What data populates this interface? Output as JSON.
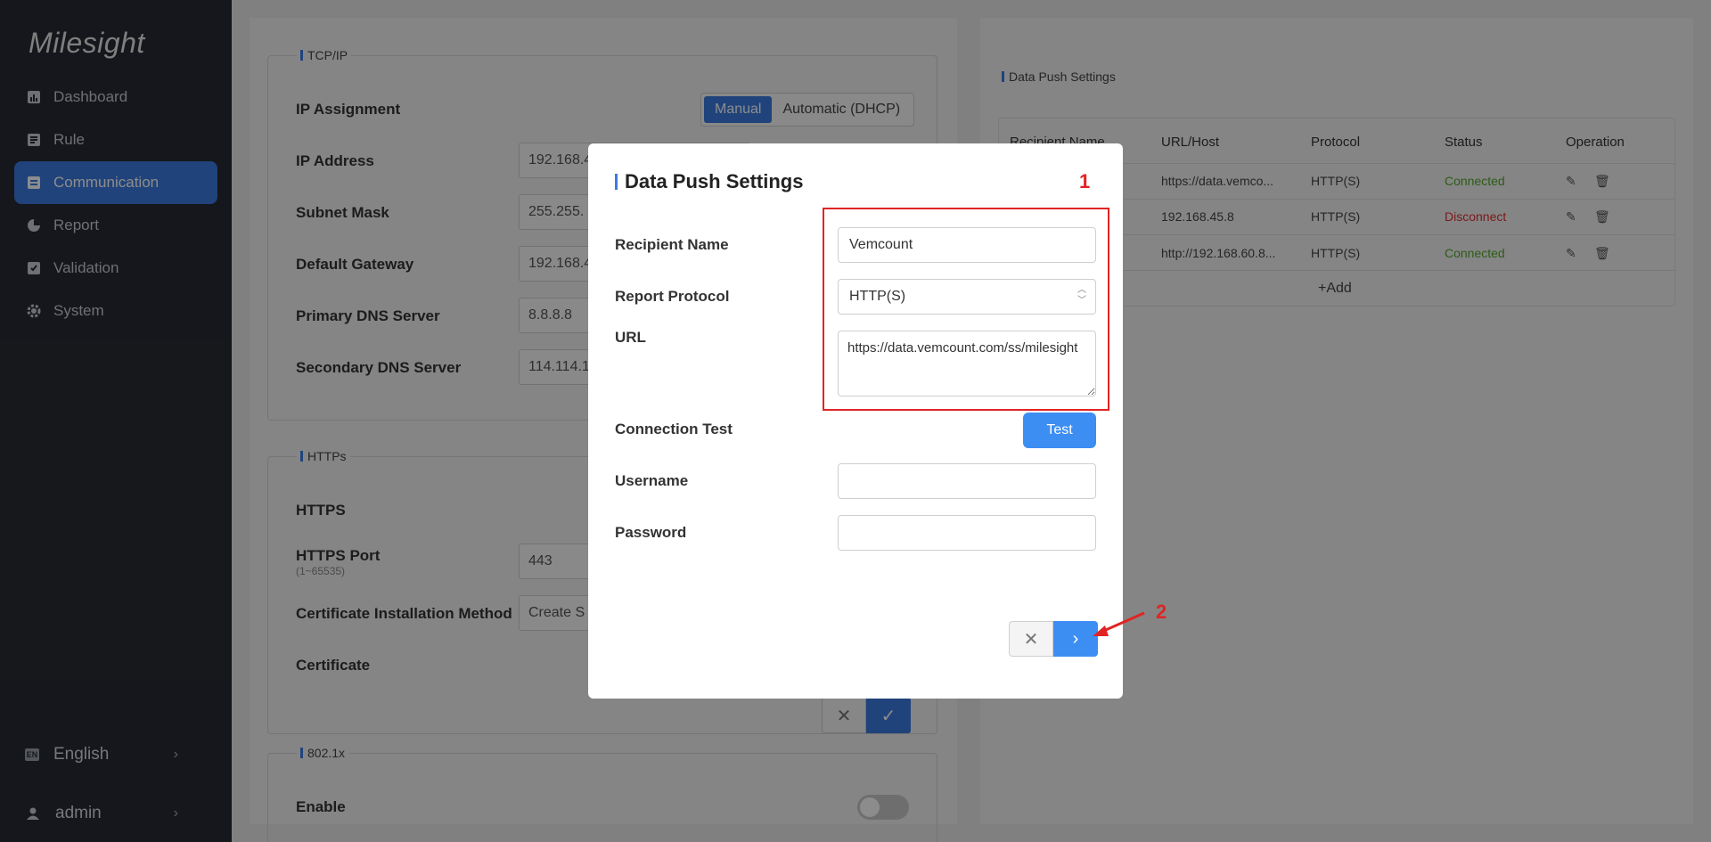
{
  "sidebar": {
    "brand": "Milesight",
    "items": [
      {
        "label": "Dashboard",
        "icon": "dashboard-icon"
      },
      {
        "label": "Rule",
        "icon": "rule-icon"
      },
      {
        "label": "Communication",
        "icon": "communication-icon",
        "active": true
      },
      {
        "label": "Report",
        "icon": "report-icon"
      },
      {
        "label": "Validation",
        "icon": "validation-icon"
      },
      {
        "label": "System",
        "icon": "gear-icon"
      }
    ],
    "language": {
      "badge": "EN",
      "label": "English"
    },
    "user": {
      "label": "admin"
    }
  },
  "tcpip": {
    "title": "TCP/IP",
    "ip_assignment_label": "IP Assignment",
    "options": [
      "Manual",
      "Automatic (DHCP)"
    ],
    "selected": "Manual",
    "fields": [
      {
        "label": "IP Address",
        "value": "192.168.4"
      },
      {
        "label": "Subnet Mask",
        "value": "255.255."
      },
      {
        "label": "Default Gateway",
        "value": "192.168.4"
      },
      {
        "label": "Primary DNS Server",
        "value": "8.8.8.8"
      },
      {
        "label": "Secondary DNS Server",
        "value": "114.114.1"
      }
    ]
  },
  "https": {
    "title": "HTTPs",
    "https_label": "HTTPS",
    "port_label": "HTTPS Port",
    "port_range": "(1~65535)",
    "port_value": "443",
    "cert_method_label": "Certificate Installation Method",
    "cert_method_value": "Create S",
    "certificate_label": "Certificate"
  },
  "dot1x": {
    "title": "802.1x",
    "enable_label": "Enable"
  },
  "data_push": {
    "title": "Data Push Settings",
    "columns": [
      "Recipient Name",
      "URL/Host",
      "Protocol",
      "Status",
      "Operation"
    ],
    "rows": [
      {
        "url": "https://data.vemco...",
        "protocol": "HTTP(S)",
        "status": "Connected"
      },
      {
        "url": "192.168.45.8",
        "protocol": "HTTP(S)",
        "status": "Disconnect"
      },
      {
        "url": "http://192.168.60.8...",
        "protocol": "HTTP(S)",
        "status": "Connected"
      }
    ],
    "add_label": "+Add",
    "colors": {
      "connected": "#52a82a",
      "disconnect": "#e0302f"
    }
  },
  "modal": {
    "title": "Data Push Settings",
    "recipient_name_label": "Recipient Name",
    "recipient_name_value": "Vemcount",
    "report_protocol_label": "Report Protocol",
    "report_protocol_value": "HTTP(S)",
    "url_label": "URL",
    "url_value": "https://data.vemcount.com/ss/milesight",
    "connection_test_label": "Connection Test",
    "test_button": "Test",
    "username_label": "Username",
    "username_value": "",
    "password_label": "Password",
    "password_value": ""
  },
  "annotations": {
    "box_number": "1",
    "arrow_number": "2",
    "color": "#e02424"
  },
  "accent_color": "#3b7be0"
}
